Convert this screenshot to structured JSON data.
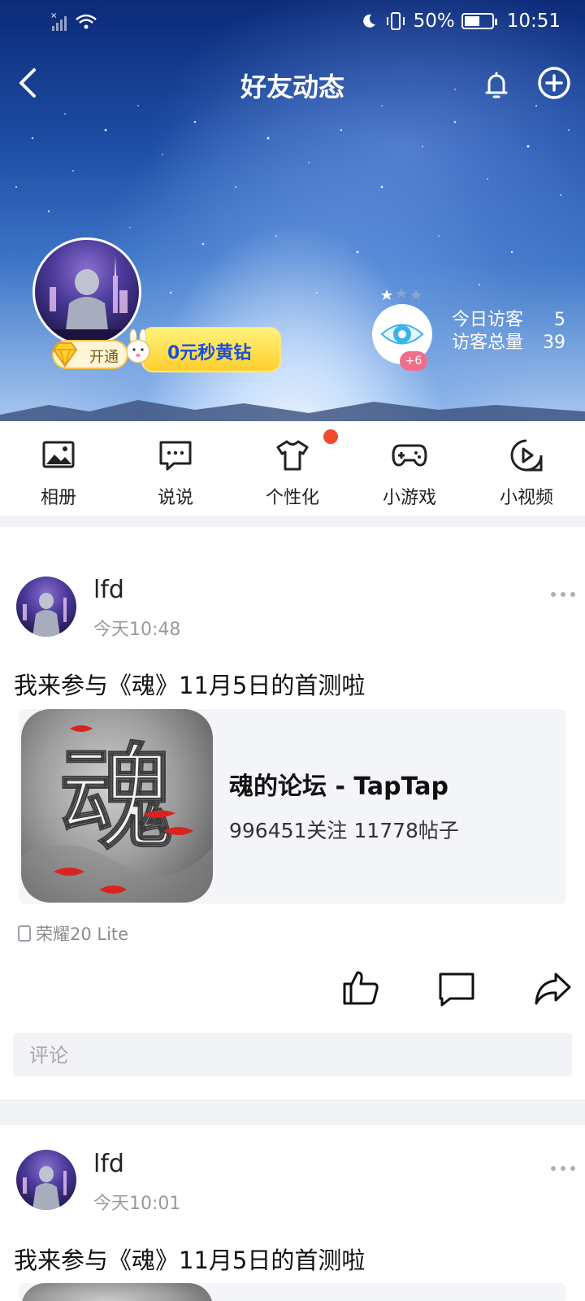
{
  "status_bar": {
    "battery": "50%",
    "time": "10:51"
  },
  "header": {
    "title": "好友动态"
  },
  "profile": {
    "vip_badge": "开通",
    "promo": "0元秒黄钻",
    "visitor_badge": "+6",
    "today_visitors_label": "今日访客",
    "today_visitors_value": "5",
    "total_visitors_label": "访客总量",
    "total_visitors_value": "39"
  },
  "quick_nav": [
    {
      "label": "相册",
      "icon": "album-icon"
    },
    {
      "label": "说说",
      "icon": "chat-icon"
    },
    {
      "label": "个性化",
      "icon": "shirt-icon"
    },
    {
      "label": "小游戏",
      "icon": "gamepad-icon"
    },
    {
      "label": "小视频",
      "icon": "play-icon"
    }
  ],
  "posts": [
    {
      "user": "lfd",
      "time": "今天10:48",
      "text": "我来参与《魂》11月5日的首测啦",
      "card": {
        "title": "魂的论坛 - TapTap",
        "subtitle": "996451关注 11778帖子",
        "image_char": "魂"
      },
      "device": "荣耀20 Lite",
      "comment_placeholder": "评论"
    },
    {
      "user": "lfd",
      "time": "今天10:01",
      "text": "我来参与《魂》11月5日的首测啦"
    }
  ],
  "colors": {
    "accent_red": "#f04b2b",
    "promo_text": "#1c4fd8",
    "promo_bg": "#ffd93a",
    "card_bg": "#f4f5f9"
  }
}
